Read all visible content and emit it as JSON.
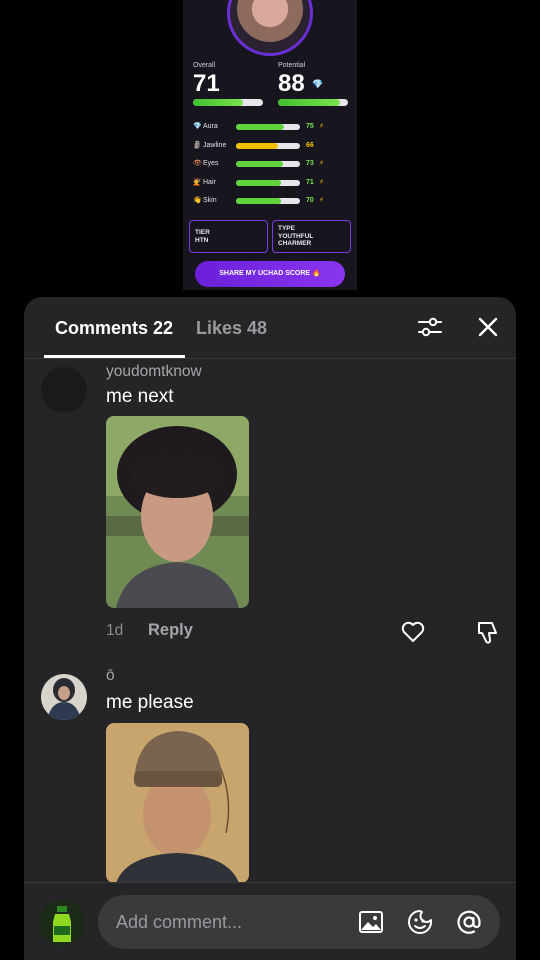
{
  "score_card": {
    "overall_label": "Overall",
    "overall_value": "71",
    "overall_fraction": 0.71,
    "potential_label": "Potential",
    "potential_value": "88",
    "potential_fraction": 0.88,
    "traits": [
      {
        "icon": "💎",
        "label": "Aura",
        "value": "75",
        "fraction": 0.75,
        "color": "#5fd23c",
        "value_color": "#7be34f",
        "bolt": true
      },
      {
        "icon": "🗿",
        "label": "Jawline",
        "value": "66",
        "fraction": 0.66,
        "color": "#f2c200",
        "value_color": "#f2c200",
        "bolt": false
      },
      {
        "icon": "👁",
        "label": "Eyes",
        "value": "73",
        "fraction": 0.73,
        "color": "#5fd23c",
        "value_color": "#7be34f",
        "bolt": true
      },
      {
        "icon": "💇",
        "label": "Hair",
        "value": "71",
        "fraction": 0.71,
        "color": "#5fd23c",
        "value_color": "#7be34f",
        "bolt": true
      },
      {
        "icon": "👋",
        "label": "Skin",
        "value": "70",
        "fraction": 0.7,
        "color": "#5fd23c",
        "value_color": "#7be34f",
        "bolt": true
      }
    ],
    "tier_label": "TIER",
    "tier_value": "HTN",
    "type_label": "TYPE",
    "type_value_line1": "YOUTHFUL",
    "type_value_line2": "CHARMER",
    "share_label": "SHARE MY UCHAD SCORE 🔥"
  },
  "tabs": {
    "comments_label": "Comments 22",
    "likes_label": "Likes 48"
  },
  "comments": [
    {
      "username": "youdomtknow",
      "text": "me next",
      "time": "1d",
      "reply_label": "Reply"
    },
    {
      "username": "ō",
      "text": "me please"
    }
  ],
  "composer": {
    "placeholder": "Add comment..."
  },
  "colors": {
    "sheet_bg": "#252527",
    "accent_purple": "#7a3ae0",
    "bar_green": "#5fd23c",
    "bar_yellow": "#f2c200"
  },
  "icons": [
    "filter-icon",
    "close-icon",
    "heart-icon",
    "dislike-icon",
    "image-icon",
    "emoji-icon",
    "mention-icon"
  ]
}
